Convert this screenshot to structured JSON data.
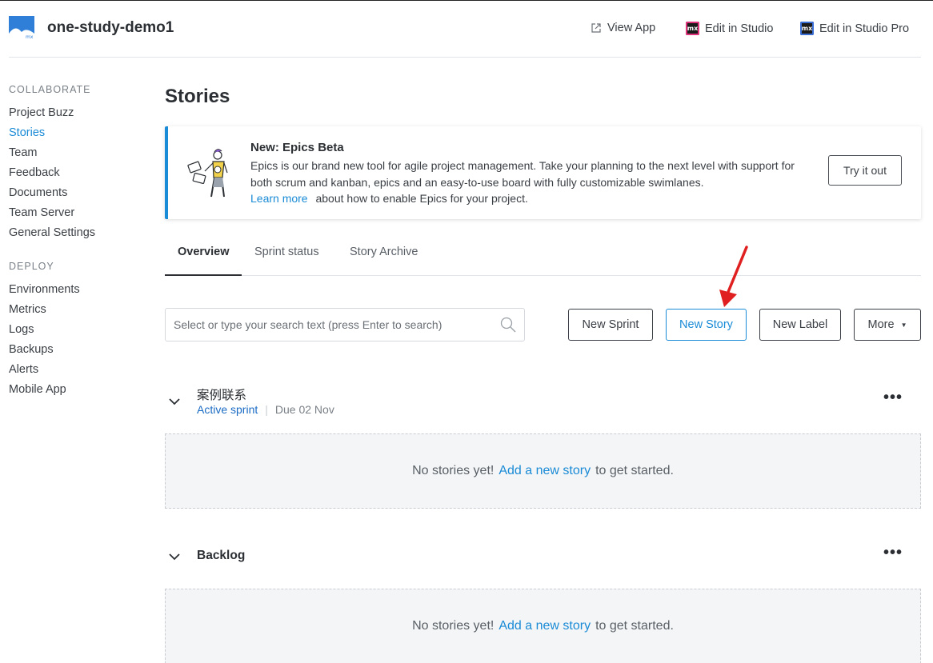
{
  "header": {
    "app_title": "one-study-demo1",
    "view_app": "View App",
    "edit_studio": "Edit in Studio",
    "edit_studio_pro": "Edit in Studio Pro",
    "mx_badge": "mx",
    "logo_text": "mx"
  },
  "sidebar": {
    "collaborate_heading": "COLLABORATE",
    "collaborate_items": [
      "Project Buzz",
      "Stories",
      "Team",
      "Feedback",
      "Documents",
      "Team Server",
      "General Settings"
    ],
    "deploy_heading": "DEPLOY",
    "deploy_items": [
      "Environments",
      "Metrics",
      "Logs",
      "Backups",
      "Alerts",
      "Mobile App"
    ],
    "active_item": "Stories"
  },
  "main": {
    "title": "Stories",
    "banner": {
      "title": "New: Epics Beta",
      "text": "Epics is our brand new tool for agile project management. Take your planning to the next level with support for both scrum and kanban, epics and an easy-to-use board with fully customizable swimlanes.",
      "learn_more": "Learn more",
      "learn_more_suffix": "about how to enable Epics for your project.",
      "try_button": "Try it out"
    },
    "tabs": [
      "Overview",
      "Sprint status",
      "Story Archive"
    ],
    "active_tab": "Overview",
    "search_placeholder": "Select or type your search text (press Enter to search)",
    "buttons": {
      "new_sprint": "New Sprint",
      "new_story": "New Story",
      "new_label": "New Label",
      "more": "More"
    },
    "sprints": [
      {
        "name": "案例联系",
        "status": "Active sprint",
        "due": "Due 02 Nov",
        "empty_prefix": "No stories yet!",
        "empty_link": "Add a new story",
        "empty_suffix": "to get started."
      },
      {
        "name": "Backlog",
        "empty_prefix": "No stories yet!",
        "empty_link": "Add a new story",
        "empty_suffix": "to get started."
      }
    ]
  },
  "colors": {
    "accent": "#1a8bd6",
    "annotation_arrow": "#e02020"
  }
}
